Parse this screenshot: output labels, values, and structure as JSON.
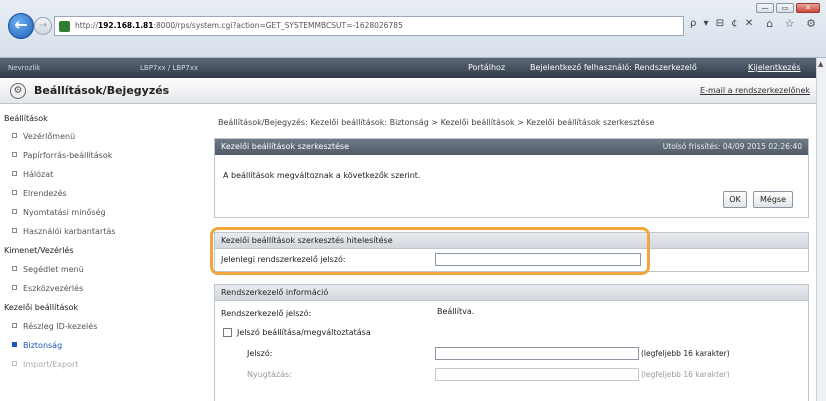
{
  "browser": {
    "url_prefix": "http://",
    "url_host": "192.168.1.81",
    "url_rest": ":8000/rps/system.cgi?action=GET_SYSTEMMBCSUT=-1628026785",
    "addr_tools": "ρ ▾ ⊟ ¢ ✕",
    "window_buttons": [
      "—",
      "▭",
      "✕"
    ],
    "icons": "⌂ ☆ ⚙"
  },
  "topbar": {
    "device_name": "Nevrozlik",
    "device_model": "LBP7xx / LBP7xx",
    "portal": "Portálhoz",
    "user_info": "Bejelentkező felhasználó: Rendszerkezelő",
    "logout": "Kijelentkezés"
  },
  "header": {
    "title": "Beállítások/Bejegyzés",
    "mail_link": "E-mail a rendszerkezelőnek"
  },
  "sidebar": {
    "groups": [
      {
        "title": "Beállítások",
        "items": [
          "Vezérlőmenü",
          "Papírforrás-beállítások",
          "Hálózat",
          "Elrendezés",
          "Nyomtatási minőség",
          "Használói karbantartás"
        ]
      },
      {
        "title": "Kimenet/Vezérlés",
        "items": [
          "Segédlet menü",
          "Eszközvezérlés"
        ]
      },
      {
        "title": "Kezelői beállítások",
        "items": [
          "Részleg ID-kezelés",
          "Biztonság",
          "Import/Export"
        ]
      }
    ]
  },
  "main": {
    "breadcrumb": "Beállítások/Bejegyzés: Kezelői beállítások: Biztonság > Kezelői beállítások > Kezelői beállítások szerkesztése",
    "panel_title": "Kezelői beállítások szerkesztése",
    "last_updated": "Utolsó frissítés: 04/09 2015 02:26:40",
    "info_text": "A beállítások megváltoznak a következők szerint.",
    "ok_button": "OK",
    "cancel_button": "Mégse",
    "auth_section": "Kezelői beállítások szerkesztés hitelesítése",
    "current_pin_label": "Jelenlegi rendszerkezelő jelszó:",
    "current_pin_value": "",
    "admin_section": "Rendszerkezelő információ",
    "admin_pin_label": "Rendszerkezelő jelszó:",
    "admin_pin_status": "Beállítva.",
    "change_checkbox_label": "Jelszó beállítása/megváltoztatása",
    "pin_label": "Jelszó:",
    "pin_hint": "(legfeljebb 16 karakter)",
    "confirm_label": "Nyugtázás:",
    "confirm_hint": "(legfeljebb 16 karakter)",
    "change_checked": false
  }
}
